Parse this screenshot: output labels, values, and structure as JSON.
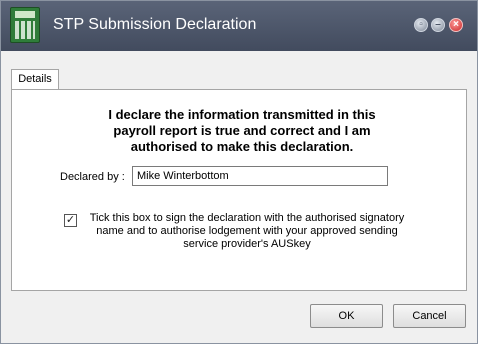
{
  "window": {
    "title": "STP Submission Declaration",
    "icon": "calculator-icon",
    "controls": [
      "restore-icon",
      "minimize-icon",
      "close-icon"
    ]
  },
  "tabs": [
    {
      "label": "Details",
      "active": true
    }
  ],
  "declaration": {
    "heading": "I declare the information transmitted in this\npayroll report is true and correct and I am\nauthorised to make this declaration.",
    "declared_by_label": "Declared by :",
    "declared_by_value": "Mike Winterbottom",
    "checkbox_checked": true,
    "checkbox_label": "Tick this box to sign the declaration with the authorised signatory\nname and to authorise lodgement with your approved sending\nservice provider's AUSkey"
  },
  "buttons": {
    "ok": "OK",
    "cancel": "Cancel"
  },
  "colors": {
    "titlebar": "#4d566a",
    "close": "#c82525"
  }
}
